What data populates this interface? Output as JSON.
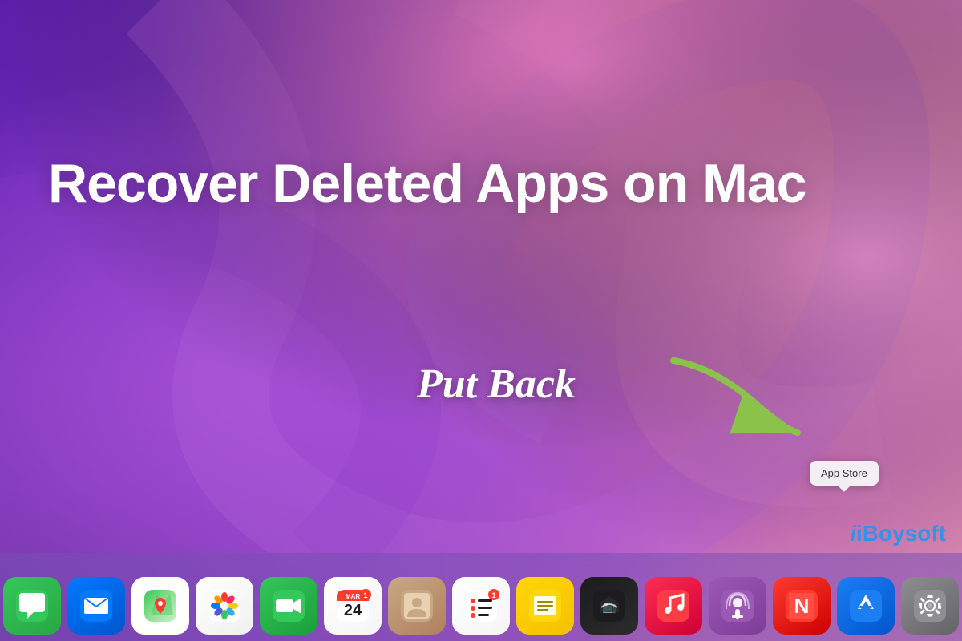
{
  "desktop": {
    "title": "Recover Deleted Apps on Mac",
    "put_back_label": "Put Back",
    "brand": "iBoysoft",
    "tooltip": {
      "label": "App Store"
    }
  },
  "dock": {
    "icons": [
      {
        "id": "messages",
        "label": "Messages",
        "class": "icon-messages"
      },
      {
        "id": "mail",
        "label": "Mail",
        "class": "icon-mail"
      },
      {
        "id": "maps",
        "label": "Maps",
        "class": "icon-maps"
      },
      {
        "id": "photos",
        "label": "Photos",
        "class": "icon-photos"
      },
      {
        "id": "facetime",
        "label": "FaceTime",
        "class": "icon-facetime"
      },
      {
        "id": "calendar",
        "label": "Calendar",
        "class": "icon-calendar"
      },
      {
        "id": "contacts",
        "label": "Contacts",
        "class": "icon-contacts"
      },
      {
        "id": "reminders",
        "label": "Reminders",
        "class": "icon-reminders"
      },
      {
        "id": "notes",
        "label": "Notes",
        "class": "icon-notes"
      },
      {
        "id": "tv",
        "label": "TV",
        "class": "icon-tv"
      },
      {
        "id": "music",
        "label": "Music",
        "class": "icon-music"
      },
      {
        "id": "podcasts",
        "label": "Podcasts",
        "class": "icon-podcasts"
      },
      {
        "id": "news",
        "label": "News",
        "class": "icon-news"
      },
      {
        "id": "appstore",
        "label": "App Store",
        "class": "icon-appstore"
      },
      {
        "id": "settings",
        "label": "System Preferences",
        "class": "icon-settings"
      }
    ]
  }
}
